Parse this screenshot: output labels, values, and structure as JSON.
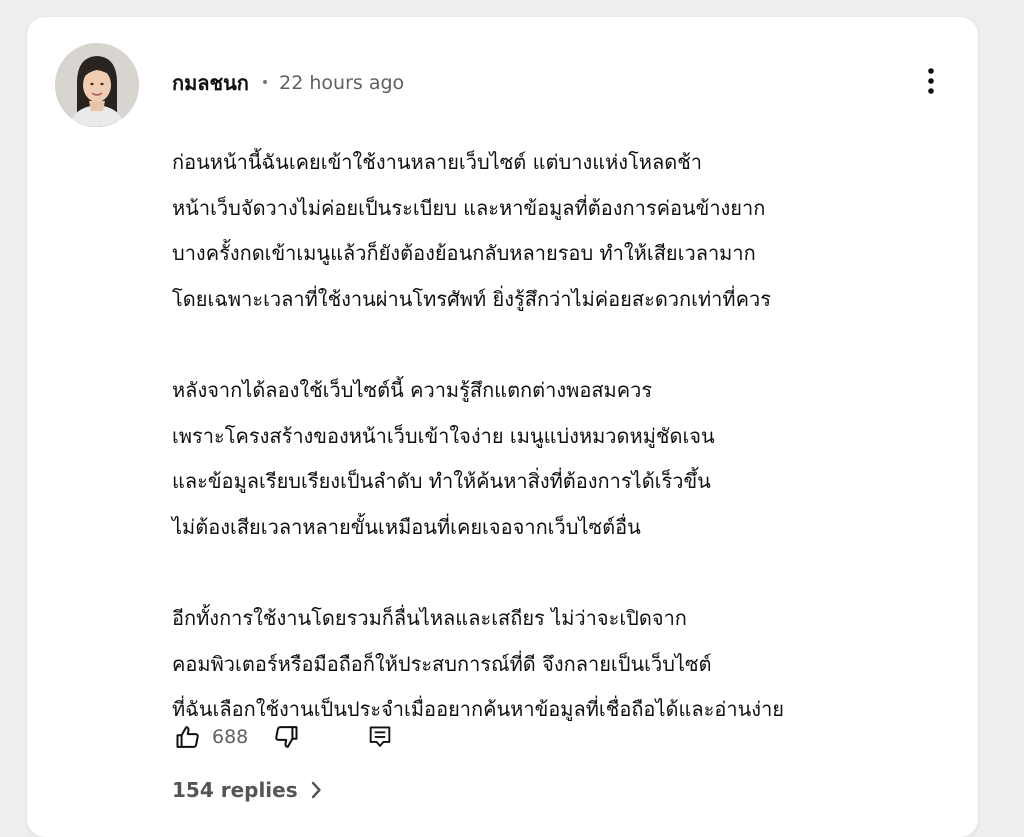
{
  "comment": {
    "author": "กมลชนก",
    "separator": "•",
    "timestamp": "22 hours ago",
    "menu_icon": "more-vertical-icon",
    "avatar_icon": "user-avatar",
    "paragraphs": [
      [
        "ก่อนหน้านี้ฉันเคยเข้าใช้งานหลายเว็บไซต์ แต่บางแห่งโหลดช้า",
        "หน้าเว็บจัดวางไม่ค่อยเป็นระเบียบ และหาข้อมูลที่ต้องการค่อนข้างยาก",
        "บางครั้งกดเข้าเมนูแล้วก็ยังต้องย้อนกลับหลายรอบ ทำให้เสียเวลามาก",
        "โดยเฉพาะเวลาที่ใช้งานผ่านโทรศัพท์ ยิ่งรู้สึกว่าไม่ค่อยสะดวกเท่าที่ควร"
      ],
      [
        "หลังจากได้ลองใช้เว็บไซต์นี้ ความรู้สึกแตกต่างพอสมควร",
        "เพราะโครงสร้างของหน้าเว็บเข้าใจง่าย เมนูแบ่งหมวดหมู่ชัดเจน",
        "และข้อมูลเรียบเรียงเป็นลำดับ ทำให้ค้นหาสิ่งที่ต้องการได้เร็วขึ้น",
        "ไม่ต้องเสียเวลาหลายขั้นเหมือนที่เคยเจอจากเว็บไซต์อื่น"
      ],
      [
        "อีกทั้งการใช้งานโดยรวมก็ลื่นไหลและเสถียร ไม่ว่าจะเปิดจาก",
        "คอมพิวเตอร์หรือมือถือก็ให้ประสบการณ์ที่ดี จึงกลายเป็นเว็บไซต์",
        "ที่ฉันเลือกใช้งานเป็นประจำเมื่ออยากค้นหาข้อมูลที่เชื่อถือได้และอ่านง่าย"
      ]
    ],
    "actions": {
      "like_icon": "thumbs-up-icon",
      "like_count": "688",
      "dislike_icon": "thumbs-down-icon",
      "reply_icon": "reply-comment-icon"
    },
    "replies": {
      "label": "154 replies",
      "icon": "chevron-right-icon"
    }
  },
  "colors": {
    "text_primary": "#0f0f0f",
    "text_secondary": "#606060",
    "card_background": "#ffffff",
    "page_background": "#eeeeee"
  }
}
